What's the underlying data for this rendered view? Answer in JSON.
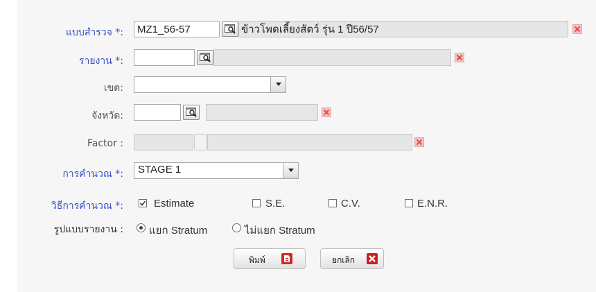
{
  "form": {
    "survey": {
      "label": "แบบสำรวจ *:",
      "code": "MZ1_56-57",
      "name": "ข้าวโพดเลี้ยงสัตว์ รุ่น 1 ปี56/57"
    },
    "report": {
      "label": "รายงาน *:",
      "code": "",
      "name": ""
    },
    "zone": {
      "label": "เขต:",
      "selected": ""
    },
    "province": {
      "label": "จังหวัด:",
      "code": "",
      "name": ""
    },
    "factor": {
      "label": "Factor :",
      "value": "",
      "name": ""
    },
    "calculation": {
      "label": "การคำนวณ *:",
      "selected": "STAGE 1"
    },
    "method": {
      "label": "วิธีการคำนวณ *:",
      "options": [
        {
          "label": "Estimate",
          "checked": true
        },
        {
          "label": "S.E.",
          "checked": false
        },
        {
          "label": "C.V.",
          "checked": false
        },
        {
          "label": "E.N.R.",
          "checked": false
        }
      ]
    },
    "report_format": {
      "label": "รูปแบบรายงาน :",
      "options": [
        {
          "label": "แยก Stratum",
          "selected": true
        },
        {
          "label": "ไม่แยก Stratum",
          "selected": false
        }
      ]
    }
  },
  "actions": {
    "print_label": "พิมพ์",
    "cancel_label": "ยกเลิก"
  },
  "icons": {
    "lookup": "magnifier-lookup-icon",
    "clear": "clear-x-icon",
    "pdf": "pdf-icon",
    "cancel": "cancel-x-icon"
  },
  "colors": {
    "required_label": "#3a4fc4",
    "clear_icon": "#d9534f",
    "pdf_icon": "#cc2a2a",
    "cancel_icon": "#cc1f1f"
  }
}
